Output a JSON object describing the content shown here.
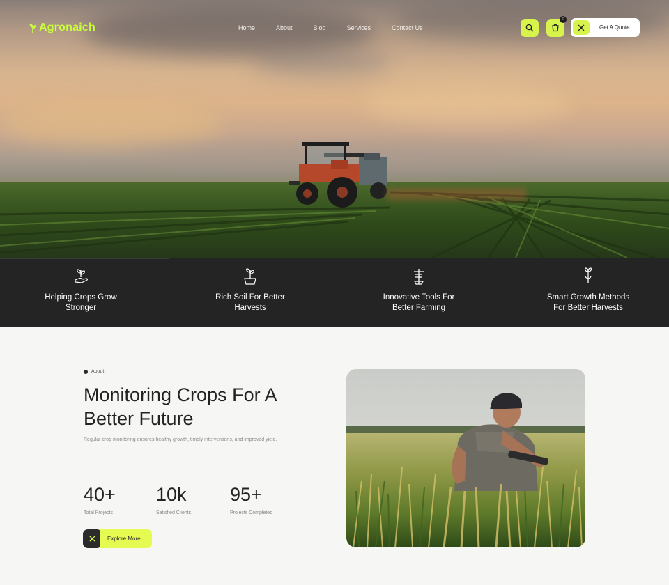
{
  "brand": {
    "name": "Agronaich",
    "accent_color": "#d8f44c",
    "dark_color": "#242424"
  },
  "nav": {
    "menu": [
      "Home",
      "About",
      "Blog",
      "Services",
      "Contact Us"
    ],
    "cart_count": "0",
    "search_icon": "search-icon",
    "cart_icon": "cart-icon",
    "quote_label": "Get A Quote"
  },
  "features": [
    {
      "icon": "hand-plant-icon",
      "line1": "Helping Crops Grow",
      "line2": "Stronger"
    },
    {
      "icon": "soil-plant-icon",
      "line1": "Rich Soil For Better",
      "line2": "Harvests"
    },
    {
      "icon": "tools-icon",
      "line1": "Innovative Tools For",
      "line2": "Better Farming"
    },
    {
      "icon": "growth-sprout-icon",
      "line1": "Smart Growth Methods",
      "line2": "For Better Harvests"
    }
  ],
  "about": {
    "tag": "About",
    "headline_line1": "Monitoring Crops For A",
    "headline_line2": "Better Future",
    "description": "Regular crop monitoring ensures healthy growth, timely interventions, and improved yield.",
    "stats": [
      {
        "value": "40+",
        "label": "Total Projects"
      },
      {
        "value": "10k",
        "label": "Satisfied Clients"
      },
      {
        "value": "95+",
        "label": "Projects Completed"
      }
    ],
    "cta_label": "Explore More"
  }
}
